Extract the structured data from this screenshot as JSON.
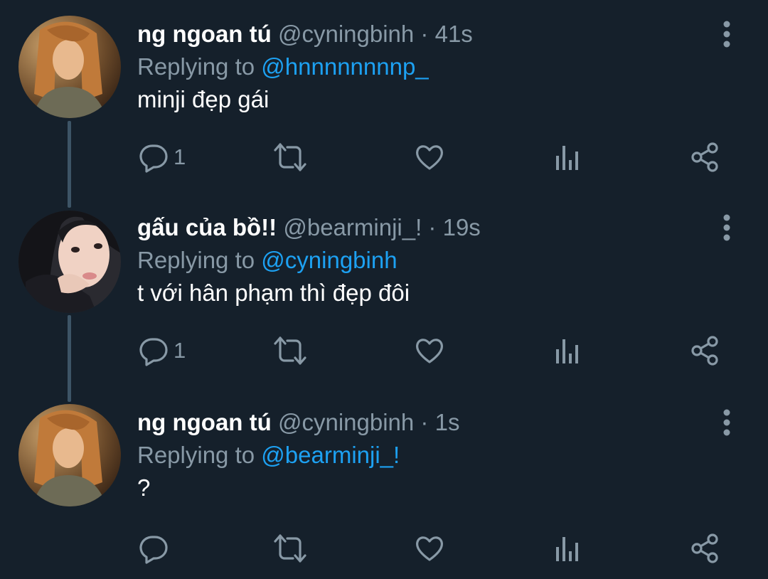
{
  "tweets": [
    {
      "name": "ng ngoan tú",
      "handle": "@cyningbinh",
      "separator": "·",
      "time": "41s",
      "replying_prefix": "Replying to",
      "replying_to": "@hnnnnnnnnp_",
      "text": "minji đẹp gái",
      "reply_count": "1",
      "avatar_icon": "profile-photo-girl-orange-tint"
    },
    {
      "name": "gấu của bồ!!",
      "handle": "@bearminji_!",
      "separator": "·",
      "time": "19s",
      "replying_prefix": "Replying to",
      "replying_to": "@cyningbinh",
      "text": "t với hân phạm thì đẹp đôi",
      "reply_count": "1",
      "avatar_icon": "profile-photo-girl-selfie"
    },
    {
      "name": "ng ngoan tú",
      "handle": "@cyningbinh",
      "separator": "·",
      "time": "1s",
      "replying_prefix": "Replying to",
      "replying_to": "@bearminji_!",
      "text": "?",
      "reply_count": "",
      "avatar_icon": "profile-photo-girl-orange-tint"
    }
  ],
  "icons": {
    "reply": "reply-icon",
    "retweet": "retweet-icon",
    "like": "heart-icon",
    "analytics": "analytics-icon",
    "share": "share-icon",
    "more": "more-vertical-icon"
  },
  "colors": {
    "background": "#15202b",
    "text": "#ffffff",
    "secondary": "#8899a6",
    "link": "#1da1f2",
    "thread_line": "#3d5466"
  }
}
